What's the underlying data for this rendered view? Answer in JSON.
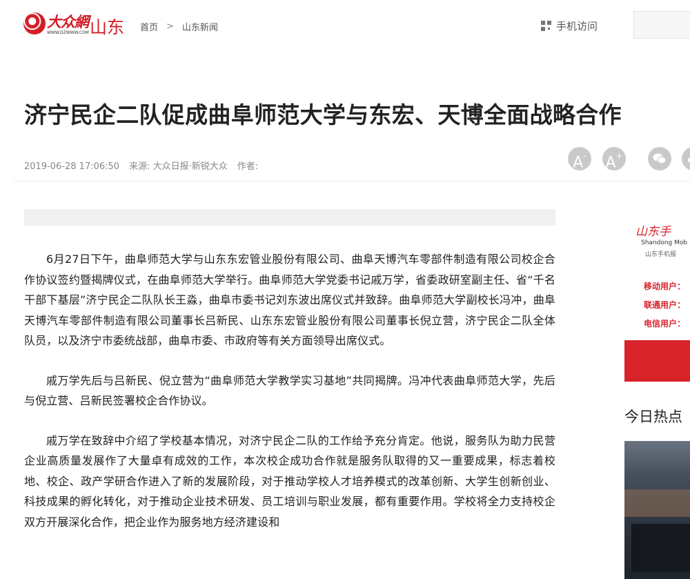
{
  "header": {
    "logo_text": "大众網",
    "logo_url": "WWW.DZWWW.COM",
    "logo_region": "山东",
    "breadcrumb": {
      "home": "首页",
      "separator": ">",
      "section": "山东新闻"
    },
    "mobile_label": "手机访问"
  },
  "article": {
    "title": "济宁民企二队促成曲阜师范大学与东宏、天博全面战略合作",
    "date": "2019-06-28 17:06:50",
    "source": "来源: 大众日报·新锐大众",
    "author": "作者:",
    "paragraphs": [
      "6月27日下午，曲阜师范大学与山东东宏管业股份有限公司、曲阜天博汽车零部件制造有限公司校企合作协议签约暨揭牌仪式，在曲阜师范大学举行。曲阜师范大学党委书记戚万学，省委政研室副主任、省“千名干部下基层”济宁民企二队队长王淼，曲阜市委书记刘东波出席仪式并致辞。曲阜师范大学副校长冯冲，曲阜天博汽车零部件制造有限公司董事长吕新民、山东东宏管业股份有限公司董事长倪立营，济宁民企二队全体队员，以及济宁市委统战部，曲阜市委、市政府等有关方面领导出席仪式。",
      "戚万学先后与吕新民、倪立营为“曲阜师范大学教学实习基地”共同揭牌。冯冲代表曲阜师范大学，先后与倪立营、吕新民签署校企合作协议。",
      "戚万学在致辞中介绍了学校基本情况，对济宁民企二队的工作给予充分肯定。他说，服务队为助力民营企业高质量发展作了大量卓有成效的工作，本次校企成功合作就是服务队取得的又一重要成果，标志着校地、校企、政产学研合作进入了新的发展阶段，对于推动学校人才培养模式的改革创新、大学生创新创业、科技成果的孵化转化，对于推动企业技术研发、员工培训与职业发展，都有重要作用。学校将全力支持校企双方开展深化合作，把企业作为服务地方经济建设和"
    ]
  },
  "tools": {
    "font_smaller": "A",
    "font_larger": "A",
    "minus": "-",
    "plus": "+"
  },
  "sidebar": {
    "promo": {
      "title": "山东手",
      "english": "Shandong Mob",
      "subtitle": "山东手机报",
      "items": [
        "移动用户：",
        "联通用户：",
        "电信用户："
      ]
    },
    "hot_title": "今日热点"
  }
}
